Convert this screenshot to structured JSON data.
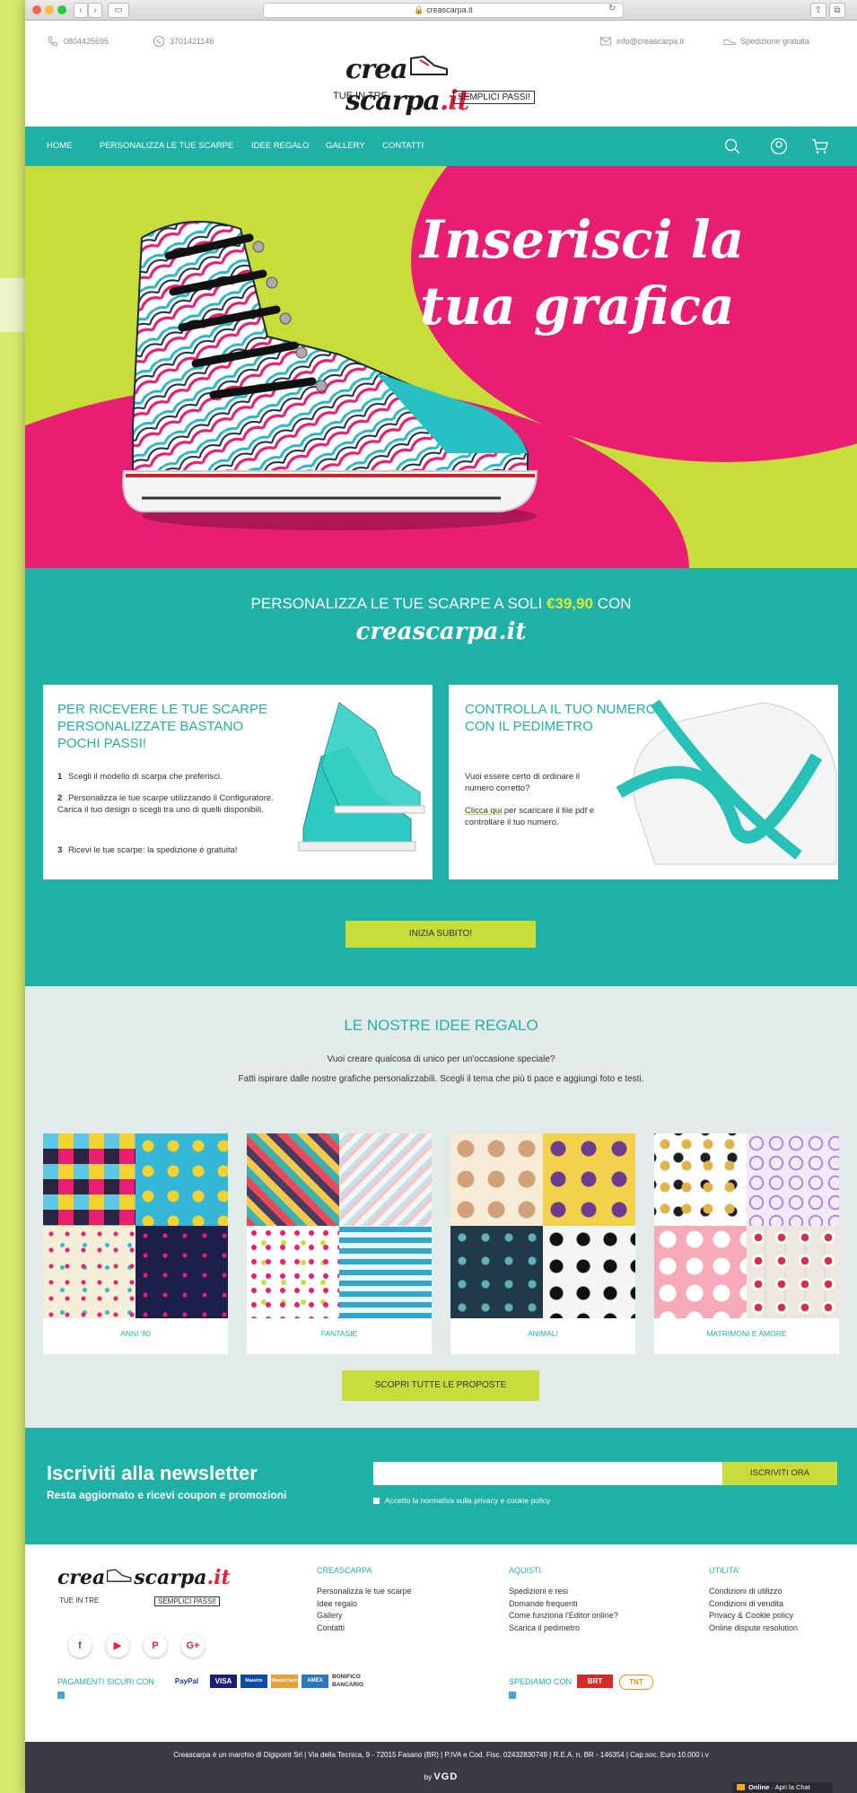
{
  "browser": {
    "url": "creascarpa.it"
  },
  "header": {
    "phone": "0804425695",
    "whatsapp": "3701421146",
    "email": "info@creascarpa.it",
    "shipping": "Spedizione gratuita",
    "logo_brand_a": "crea",
    "logo_brand_b": "scarpa",
    "logo_brand_c": ".it",
    "logo_tag_a": "TUE IN TRE",
    "logo_tag_b": "SEMPLICI PASSI!"
  },
  "nav": {
    "items": [
      "HOME",
      "PERSONALIZZA LE TUE SCARPE",
      "IDEE REGALO",
      "GALLERY",
      "CONTATTI"
    ]
  },
  "hero": {
    "title_line1": "Inserisci la",
    "title_line2": "tua grafica"
  },
  "promo": {
    "headline_a": "PERSONALIZZA LE TUE SCARPE A SOLI",
    "price": "€39,90",
    "headline_b": "CON",
    "brand": "creascarpa.it",
    "card1": {
      "title": "PER RICEVERE LE TUE SCARPE PERSONALIZZATE BASTANO POCHI PASSI!",
      "steps": [
        {
          "n": "1",
          "text": "Scegli il modello di scarpa che preferisci."
        },
        {
          "n": "2",
          "text": "Personalizza le tue scarpe utilizzando il Configuratore. Carica il tuo design o scegli tra uno di quelli disponibili."
        },
        {
          "n": "3",
          "text": "Ricevi le tue scarpe: la spedizione è gratuita!"
        }
      ]
    },
    "card2": {
      "title": "CONTROLLA IL TUO NUMERO CON IL PEDIMETRO",
      "text1": "Vuoi essere certo di ordinare il numero corretto?",
      "link": "Clicca qui",
      "text2": "per scaricare il file pdf e controllare il tuo numero."
    },
    "cta": "INIZIA SUBITO!"
  },
  "ideas": {
    "title": "LE NOSTRE IDEE REGALO",
    "line1": "Vuoi creare qualcosa di unico per un'occasione speciale?",
    "line2": "Fatti ispirare dalle nostre grafiche personalizzabili. Scegli il tema che più ti pace e aggiungi foto e testi.",
    "categories": [
      "ANNI '80",
      "FANTASIE",
      "ANIMALI",
      "MATRIMONI E AMORE"
    ],
    "cta": "SCOPRI TUTTE LE PROPOSTE"
  },
  "newsletter": {
    "title": "Iscriviti alla newsletter",
    "subtitle": "Resta aggiornato e ricevi coupon e promozioni",
    "button": "ISCRIVITI ORA",
    "consent": "Accetto la normativa sulla privacy e cookie policy"
  },
  "footer": {
    "col1": {
      "title": "CREASCARPA",
      "links": [
        "Personalizza le tue scarpe",
        "Idee regalo",
        "Gallery",
        "Contatti"
      ]
    },
    "col2": {
      "title": "AQUISTI",
      "links": [
        "Spedizioni e resi",
        "Domande frequenti",
        "Come funziona l'Editor online?",
        "Scarica il pedimetro"
      ]
    },
    "col3": {
      "title": "UTILITA'",
      "links": [
        "Condizioni di utilizzo",
        "Condizioni di vendita",
        "Privacy & Cookie policy",
        "Online dispute resolution"
      ]
    },
    "social": [
      "f",
      "▶",
      "P",
      "G+"
    ],
    "payments_label": "PAGAMENTI SICURI CON",
    "payments": [
      "PayPal",
      "VISA",
      "Maestro",
      "MasterCard",
      "AMEX",
      "BONIFICO BANCARIO"
    ],
    "shipping_label": "SPEDIAMO CON",
    "couriers": [
      "BRT",
      "TNT"
    ],
    "copyright": "Creascarpa è un marchio di Digipoint Srl | Via della Tecnica, 9 - 72015 Fasano (BR) | P.IVA e Cod. Fisc. 02432830749 | R.E.A. n. BR - 146354 | Cap.soc. Euro 10.000 i.v",
    "by": "by",
    "credit_logo": "VGD"
  },
  "chat": {
    "status": "Online",
    "action": "Apri la Chat"
  },
  "colors": {
    "teal": "#1fb1a5",
    "lime": "#c7de3a",
    "pink": "#e91e72",
    "dark": "#3c3a47"
  }
}
